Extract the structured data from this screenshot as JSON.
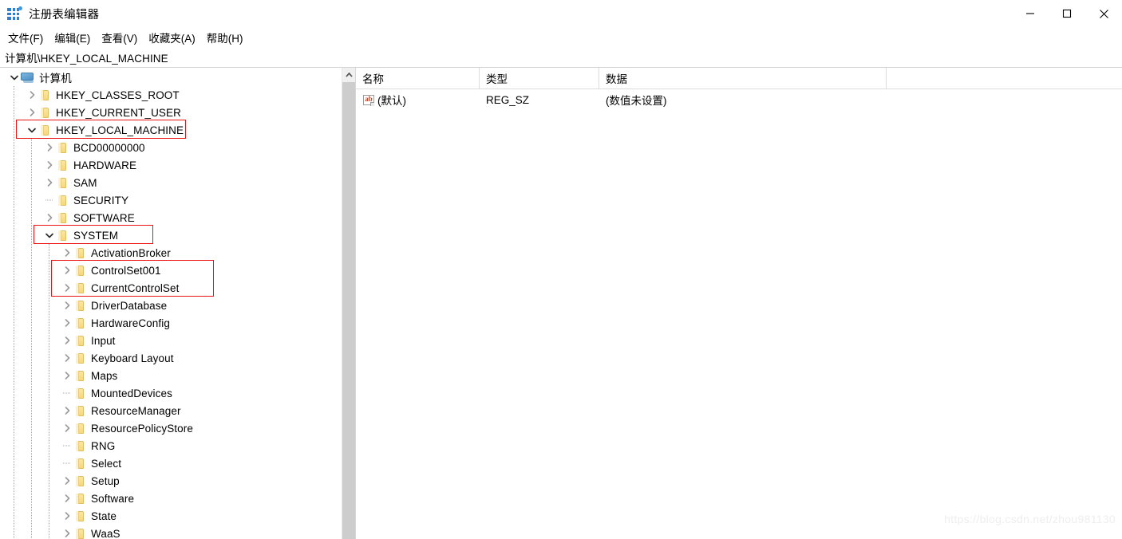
{
  "window": {
    "title": "注册表编辑器",
    "app_icon": "registry-grid-icon",
    "controls": {
      "minimize": "minimize-icon",
      "maximize": "maximize-icon",
      "close": "close-icon"
    }
  },
  "menubar": {
    "items": [
      {
        "label": "文件(F)"
      },
      {
        "label": "编辑(E)"
      },
      {
        "label": "查看(V)"
      },
      {
        "label": "收藏夹(A)"
      },
      {
        "label": "帮助(H)"
      }
    ]
  },
  "addressbar": {
    "path": "计算机\\HKEY_LOCAL_MACHINE"
  },
  "tree": {
    "nodes": [
      {
        "label": "计算机",
        "depth": 0,
        "state": "expanded",
        "icon": "computer-icon"
      },
      {
        "label": "HKEY_CLASSES_ROOT",
        "depth": 1,
        "state": "collapsed",
        "icon": "folder-icon"
      },
      {
        "label": "HKEY_CURRENT_USER",
        "depth": 1,
        "state": "collapsed",
        "icon": "folder-icon"
      },
      {
        "label": "HKEY_LOCAL_MACHINE",
        "depth": 1,
        "state": "expanded",
        "icon": "folder-icon",
        "selected": true,
        "annotated": true
      },
      {
        "label": "BCD00000000",
        "depth": 2,
        "state": "collapsed",
        "icon": "folder-icon"
      },
      {
        "label": "HARDWARE",
        "depth": 2,
        "state": "collapsed",
        "icon": "folder-icon"
      },
      {
        "label": "SAM",
        "depth": 2,
        "state": "collapsed",
        "icon": "folder-icon"
      },
      {
        "label": "SECURITY",
        "depth": 2,
        "state": "leaf",
        "icon": "folder-icon"
      },
      {
        "label": "SOFTWARE",
        "depth": 2,
        "state": "collapsed",
        "icon": "folder-icon"
      },
      {
        "label": "SYSTEM",
        "depth": 2,
        "state": "expanded",
        "icon": "folder-icon",
        "annotated": true
      },
      {
        "label": "ActivationBroker",
        "depth": 3,
        "state": "collapsed",
        "icon": "folder-icon"
      },
      {
        "label": "ControlSet001",
        "depth": 3,
        "state": "collapsed",
        "icon": "folder-icon",
        "annotated": true
      },
      {
        "label": "CurrentControlSet",
        "depth": 3,
        "state": "collapsed",
        "icon": "folder-icon",
        "annotated": true
      },
      {
        "label": "DriverDatabase",
        "depth": 3,
        "state": "collapsed",
        "icon": "folder-icon"
      },
      {
        "label": "HardwareConfig",
        "depth": 3,
        "state": "collapsed",
        "icon": "folder-icon"
      },
      {
        "label": "Input",
        "depth": 3,
        "state": "collapsed",
        "icon": "folder-icon"
      },
      {
        "label": "Keyboard Layout",
        "depth": 3,
        "state": "collapsed",
        "icon": "folder-icon"
      },
      {
        "label": "Maps",
        "depth": 3,
        "state": "collapsed",
        "icon": "folder-icon"
      },
      {
        "label": "MountedDevices",
        "depth": 3,
        "state": "leaf",
        "icon": "folder-icon"
      },
      {
        "label": "ResourceManager",
        "depth": 3,
        "state": "collapsed",
        "icon": "folder-icon"
      },
      {
        "label": "ResourcePolicyStore",
        "depth": 3,
        "state": "collapsed",
        "icon": "folder-icon"
      },
      {
        "label": "RNG",
        "depth": 3,
        "state": "leaf",
        "icon": "folder-icon"
      },
      {
        "label": "Select",
        "depth": 3,
        "state": "leaf",
        "icon": "folder-icon"
      },
      {
        "label": "Setup",
        "depth": 3,
        "state": "collapsed",
        "icon": "folder-icon"
      },
      {
        "label": "Software",
        "depth": 3,
        "state": "collapsed",
        "icon": "folder-icon"
      },
      {
        "label": "State",
        "depth": 3,
        "state": "collapsed",
        "icon": "folder-icon"
      },
      {
        "label": "WaaS",
        "depth": 3,
        "state": "collapsed",
        "icon": "folder-icon"
      }
    ],
    "scrollbar": {
      "up_arrow": "chevron-up-icon"
    }
  },
  "list": {
    "columns": [
      {
        "label": "名称"
      },
      {
        "label": "类型"
      },
      {
        "label": "数据"
      }
    ],
    "rows": [
      {
        "name": "(默认)",
        "type": "REG_SZ",
        "data": "(数值未设置)",
        "icon": "string-value-icon"
      }
    ]
  },
  "watermark": {
    "text": "https://blog.csdn.net/zhou981130"
  },
  "colors": {
    "selection": "#cce8ff",
    "annotation": "#e81313",
    "folder": "#f6d87c",
    "accent": "#2a7fd4"
  }
}
